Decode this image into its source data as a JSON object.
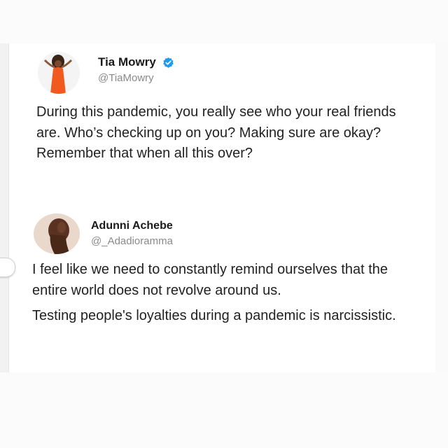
{
  "tweets": [
    {
      "display_name": "Tia Mowry",
      "handle": "@TiaMowry",
      "verified": true,
      "avatar_icon": "woman-in-orange-dress-avatar",
      "body": "During this pandemic, you really see who your real friends are.  Who’s checking up on you? Making sure are okay? Remember that when all this over?"
    },
    {
      "display_name": "Adunni Achebe",
      "handle": "@_Adadioramma",
      "verified": false,
      "avatar_icon": "bald-woman-profile-avatar",
      "paragraphs": [
        "I feel like we need to constantly remind ourselves that the entire world does not revolve around us.",
        "Testing people's loyalties during a pandemic is narcissistic."
      ]
    }
  ],
  "colors": {
    "verified_badge": "#1d9bf0",
    "handle_text": "#8a8a8a",
    "body_text": "#222222",
    "background": "#ffffff"
  }
}
